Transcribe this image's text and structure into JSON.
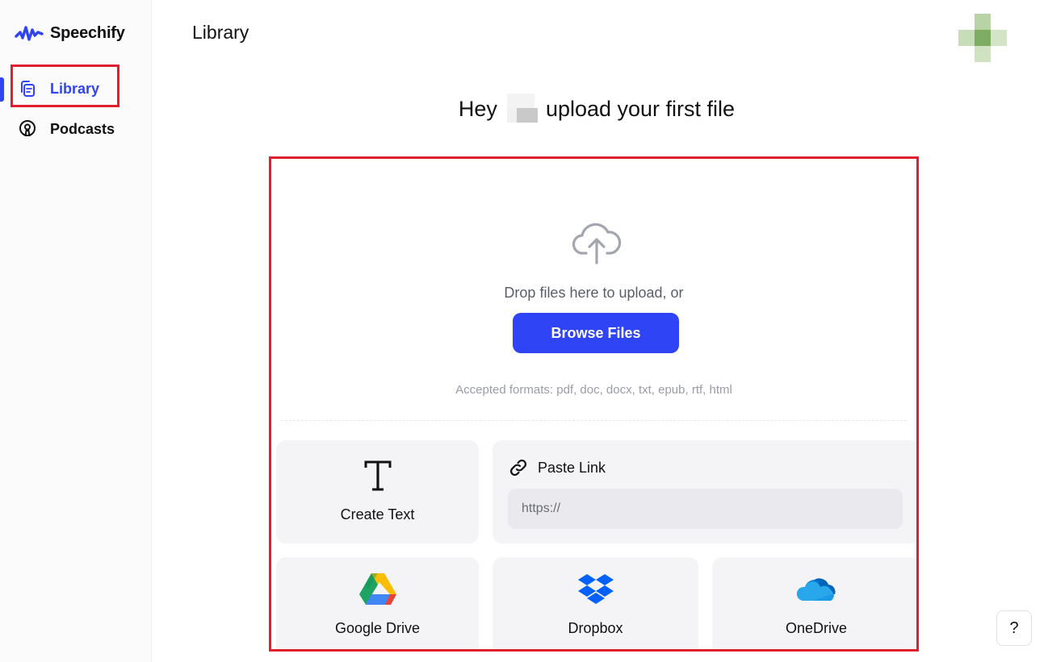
{
  "app": {
    "name": "Speechify"
  },
  "sidebar": {
    "items": [
      {
        "label": "Library",
        "icon": "library-icon",
        "active": true
      },
      {
        "label": "Podcasts",
        "icon": "podcast-icon",
        "active": false
      }
    ]
  },
  "header": {
    "title": "Library"
  },
  "greeting": {
    "prefix": "Hey",
    "suffix": "upload your first file"
  },
  "upload": {
    "drop_text": "Drop files here to upload, or",
    "browse_label": "Browse Files",
    "accepted_formats": "Accepted formats: pdf, doc, docx, txt, epub, rtf, html"
  },
  "sources": {
    "create_text": "Create Text",
    "paste_link": {
      "label": "Paste Link",
      "placeholder": "https://"
    },
    "google_drive": "Google Drive",
    "dropbox": "Dropbox",
    "onedrive": "OneDrive"
  },
  "help": {
    "label": "?"
  },
  "colors": {
    "accent": "#2f44f5",
    "highlight": "#e01e2e"
  }
}
